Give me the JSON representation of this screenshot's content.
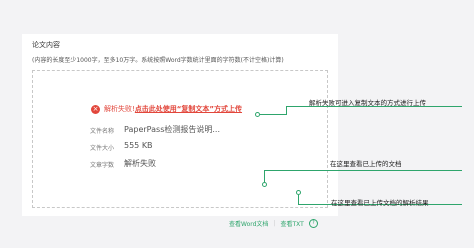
{
  "form": {
    "title": "论文内容",
    "hint": "(内容的长度至少1000字，至多10万字。系统按照Word字数统计里面的字符数(不计空格)计算)"
  },
  "status": {
    "error_text": "解析失败! ",
    "error_link": "点击此处使用“复制文本”方式上传",
    "error_icon": "close-circle-icon"
  },
  "file": {
    "name_label": "文件名称",
    "name_value": "PaperPass检测报告说明...",
    "size_label": "文件大小",
    "size_value": "555 KB",
    "count_label": "文章字数",
    "count_value": "解析失败"
  },
  "actions": {
    "view_word": "查看Word文档",
    "divider": "|",
    "view_txt": "查看TXT",
    "help_icon": "question-circle-icon"
  },
  "callouts": {
    "first": "解析失败可进入复制文本的方式进行上传",
    "second": "在这里查看已上传的文档",
    "third": "在这里查看已上传文档的解析结果"
  },
  "colors": {
    "error": "#e2463b",
    "accent": "#2ea56c",
    "card": "#ffffff",
    "background": "#f3f3f5"
  }
}
